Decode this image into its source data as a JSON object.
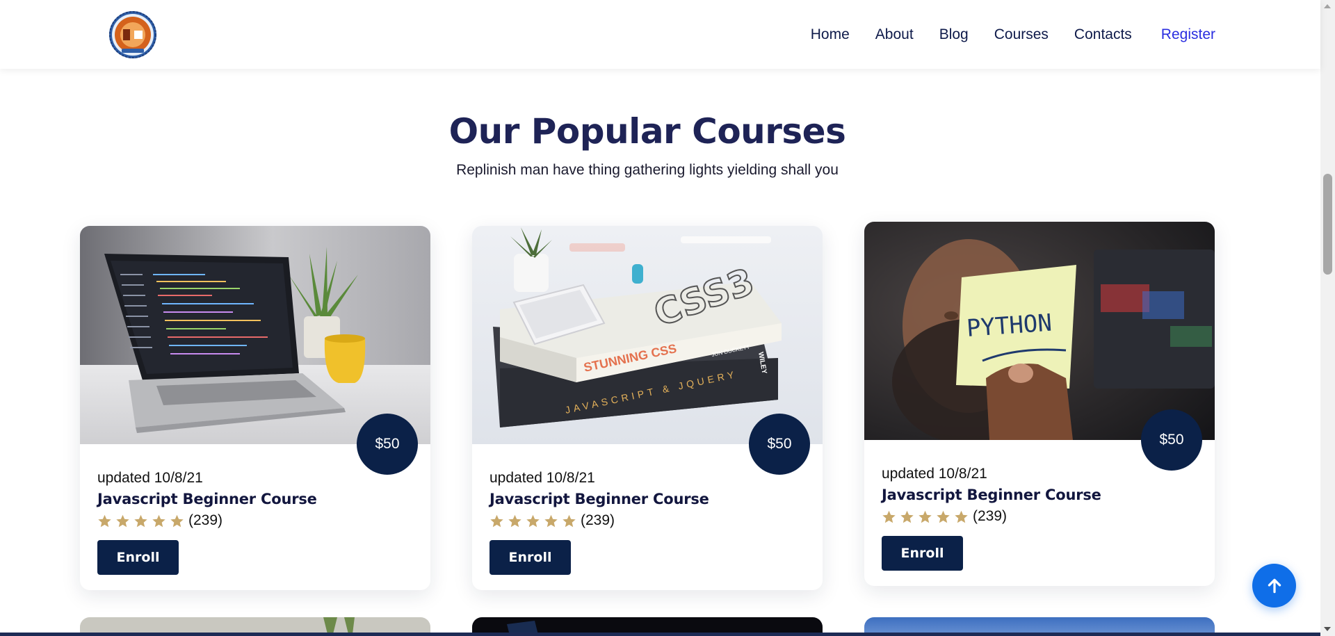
{
  "nav": {
    "items": [
      "Home",
      "About",
      "Blog",
      "Courses",
      "Contacts"
    ],
    "register": "Register"
  },
  "section": {
    "title": "Our Popular Courses",
    "subtitle": "Replinish man have thing gathering lights yielding shall you"
  },
  "courses": [
    {
      "image": "laptop-code-photo",
      "price": "$50",
      "updated": "updated 10/8/21",
      "title": "Javascript Beginner Course",
      "rating": 5,
      "count": "(239)",
      "enroll": "Enroll"
    },
    {
      "image": "css-books-photo",
      "price": "$50",
      "updated": "updated 10/8/21",
      "title": "Javascript Beginner Course",
      "rating": 5,
      "count": "(239)",
      "enroll": "Enroll"
    },
    {
      "image": "python-note-photo",
      "price": "$50",
      "updated": "updated 10/8/21",
      "title": "Javascript Beginner Course",
      "rating": 5,
      "count": "(239)",
      "enroll": "Enroll"
    }
  ],
  "book_text": {
    "stunning_css": "STUNNING CSS",
    "javascript_jquery": "JAVASCRIPT & JQUERY",
    "wiley": "WILEY",
    "jon_duckett": "JON DUCKETT",
    "css_spine": "CSS3"
  },
  "note_text": "PYTHON",
  "colors": {
    "navy": "#0b2148",
    "title": "#1e2356",
    "register": "#2a2ee0",
    "star": "#c8a86a",
    "top_button": "#0f6ee8"
  },
  "icons": {
    "logo": "college-emblem-logo",
    "star": "star-icon",
    "to_top": "arrow-up-icon"
  }
}
